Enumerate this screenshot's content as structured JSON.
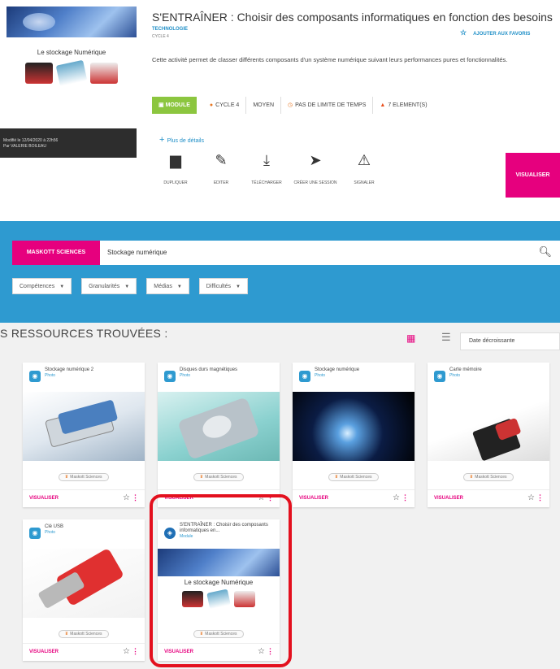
{
  "top": {
    "thumb_caption": "Le stockage Numérique",
    "modified": "Modifié le 12/04/2020 à 22h56",
    "author": "Par VALERIE BOILEAU",
    "title": "S'ENTRAÎNER : Choisir des composants informatiques en fonction des besoins",
    "subject": "TECHNOLOGIE",
    "cycle_small": "CYCLE 4",
    "favorite_label": "AJOUTER AUX FAVORIS",
    "description": "Cette activité permet de classer différents composants d'un système numérique suivant leurs performances pures et fonctionnalités.",
    "chips": {
      "module": "MODULE",
      "cycle": "CYCLE 4",
      "level": "MOYEN",
      "time": "PAS DE LIMITE DE TEMPS",
      "elements": "7 ELEMENT(S)"
    },
    "details_label": "Plus de détails",
    "actions": [
      {
        "label": "DUPLIQUER",
        "icon": "copy-icon"
      },
      {
        "label": "EDITER",
        "icon": "pencil-icon"
      },
      {
        "label": "TÉLÉCHARGER",
        "icon": "download-icon"
      },
      {
        "label": "CRÉER UNE SESSION",
        "icon": "send-icon"
      },
      {
        "label": "SIGNALER",
        "icon": "warning-icon"
      }
    ],
    "visualiser": "VISUALISER"
  },
  "search": {
    "brand": "MASKOTT SCIENCES",
    "query": "Stockage numérique",
    "filters": [
      "Compétences",
      "Granularités",
      "Médias",
      "Difficultés"
    ]
  },
  "results": {
    "title": "S RESSOURCES TROUVÉES :",
    "sort": "Date décroissante",
    "cards": [
      {
        "title": "Stockage numérique 2",
        "type": "Photo",
        "tag": "Maskott Sciences",
        "action": "VISUALISER"
      },
      {
        "title": "Disques durs magnétiques",
        "type": "Photo",
        "tag": "Maskott Sciences",
        "action": "VISUALISER"
      },
      {
        "title": "Stockage numérique",
        "type": "Photo",
        "tag": "Maskott Sciences",
        "action": "VISUALISER"
      },
      {
        "title": "Carte mémoire",
        "type": "Photo",
        "tag": "Maskott Sciences",
        "action": "VISUALISER"
      },
      {
        "title": "Clé USB",
        "type": "Photo",
        "tag": "Maskott Sciences",
        "action": "VISUALISER"
      },
      {
        "title": "S'ENTRAÎNER : Choisir des composants informatiques en...",
        "type": "Module",
        "tag": "Maskott Sciences",
        "action": "VISUALISER",
        "image_caption": "Le stockage Numérique"
      }
    ]
  },
  "colors": {
    "brand_pink": "#e6007e",
    "blue_band": "#2e9ad0",
    "module_green": "#8cc63f",
    "highlight_red": "#e3101e"
  }
}
